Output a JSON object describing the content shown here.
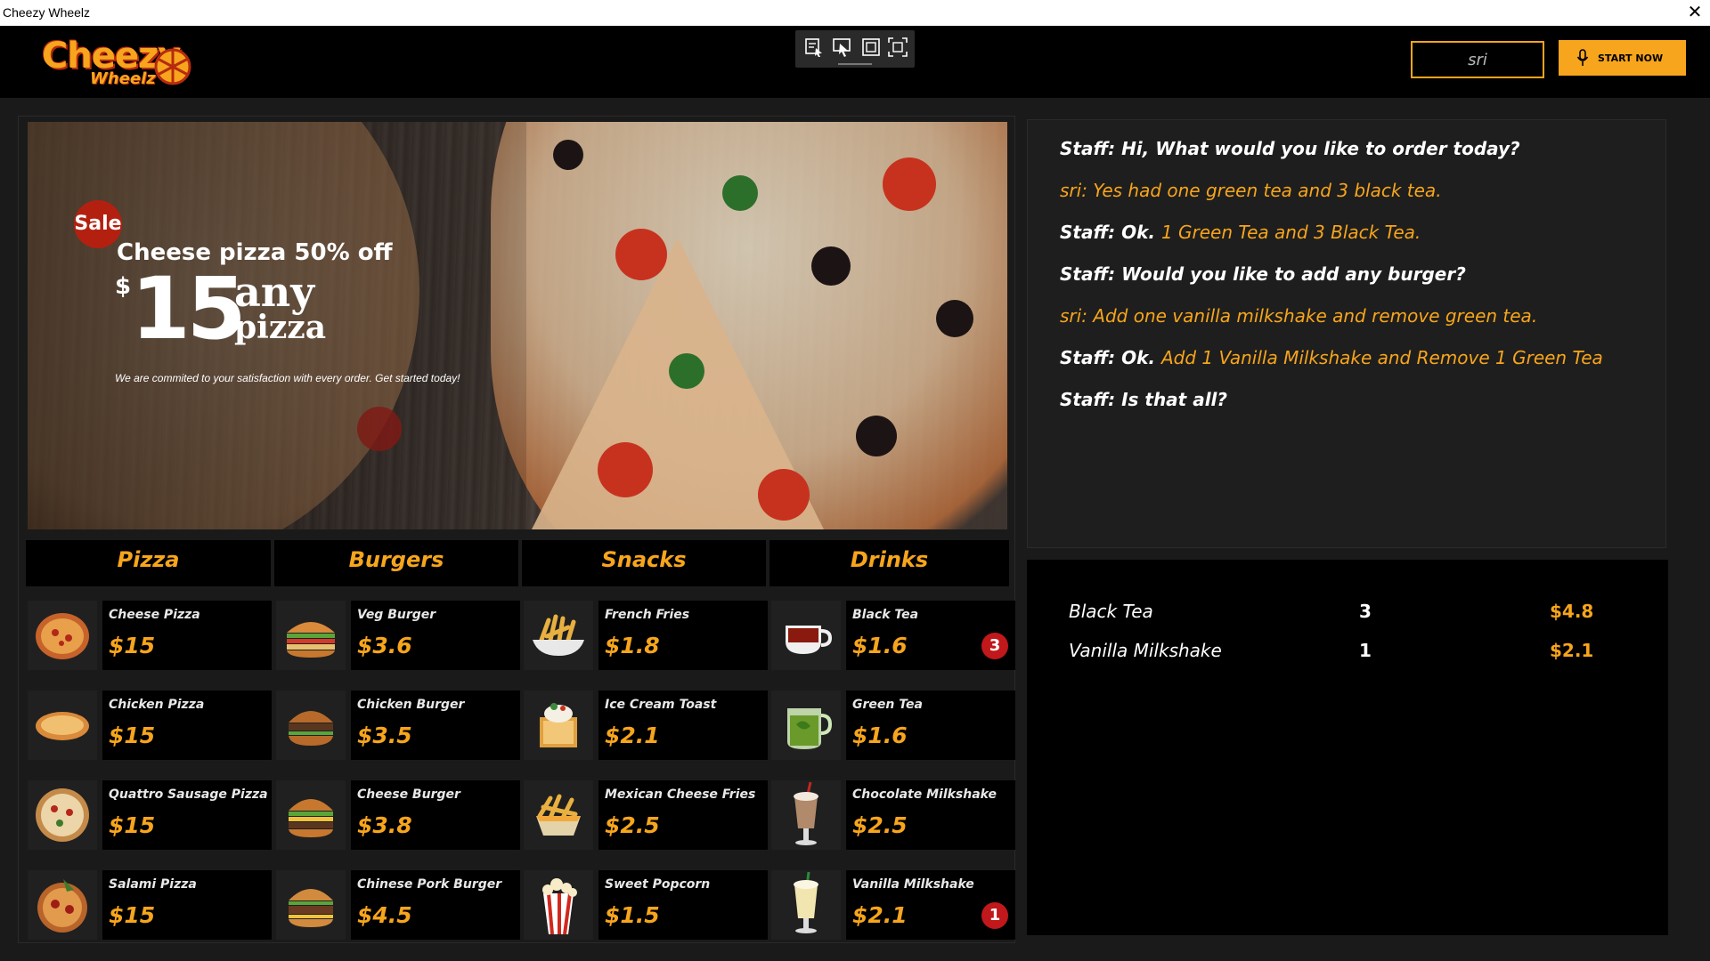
{
  "window": {
    "title": "Cheezy Wheelz",
    "close_glyph": "✕"
  },
  "header": {
    "logo_main": "Cheezy",
    "logo_sub": "Wheelz",
    "name_value": "sri",
    "start_label": "START NOW"
  },
  "banner": {
    "sale": "Sale",
    "title": "Cheese pizza 50% off",
    "currency": "$",
    "price": "15",
    "any": "any",
    "pizza": "pizza",
    "tagline": "We are commited to your satisfaction with every order. Get started today!"
  },
  "tabs": [
    "Pizza",
    "Burgers",
    "Snacks",
    "Drinks"
  ],
  "menu": {
    "pizza": [
      {
        "name": "Cheese Pizza",
        "price": "$15"
      },
      {
        "name": "Chicken Pizza",
        "price": "$15"
      },
      {
        "name": "Quattro Sausage Pizza",
        "price": "$15"
      },
      {
        "name": "Salami Pizza",
        "price": "$15"
      }
    ],
    "burgers": [
      {
        "name": "Veg Burger",
        "price": "$3.6"
      },
      {
        "name": "Chicken Burger",
        "price": "$3.5"
      },
      {
        "name": "Cheese Burger",
        "price": "$3.8"
      },
      {
        "name": "Chinese Pork Burger",
        "price": "$4.5"
      }
    ],
    "snacks": [
      {
        "name": "French Fries",
        "price": "$1.8"
      },
      {
        "name": "Ice Cream Toast",
        "price": "$2.1"
      },
      {
        "name": "Mexican Cheese Fries",
        "price": "$2.5"
      },
      {
        "name": "Sweet Popcorn",
        "price": "$1.5"
      }
    ],
    "drinks": [
      {
        "name": "Black Tea",
        "price": "$1.6",
        "badge": "3"
      },
      {
        "name": "Green Tea",
        "price": "$1.6"
      },
      {
        "name": "Chocolate Milkshake",
        "price": "$2.5"
      },
      {
        "name": "Vanilla Milkshake",
        "price": "$2.1",
        "badge": "1"
      }
    ]
  },
  "chat": [
    {
      "white": "Staff: Hi, What would you like to order today?",
      "orange": ""
    },
    {
      "white": "",
      "orange": "sri: Yes had one green tea and 3 black tea."
    },
    {
      "white": "Staff: Ok. ",
      "orange": "1 Green Tea and 3 Black Tea."
    },
    {
      "white": "Staff: Would you like to add any burger?",
      "orange": ""
    },
    {
      "white": "",
      "orange": "sri: Add one vanilla milkshake and remove green tea."
    },
    {
      "white": "Staff: Ok. ",
      "orange": "Add 1 Vanilla Milkshake and Remove 1 Green Tea"
    },
    {
      "white": "Staff: Is that all?",
      "orange": ""
    }
  ],
  "order": [
    {
      "name": "Black Tea",
      "qty": "3",
      "price": "$4.8"
    },
    {
      "name": "Vanilla Milkshake",
      "qty": "1",
      "price": "$2.1"
    }
  ],
  "colors": {
    "accent": "#f7a51c",
    "badge": "#c0181b",
    "sale": "#b3200f",
    "background": "#1a1a1a"
  }
}
